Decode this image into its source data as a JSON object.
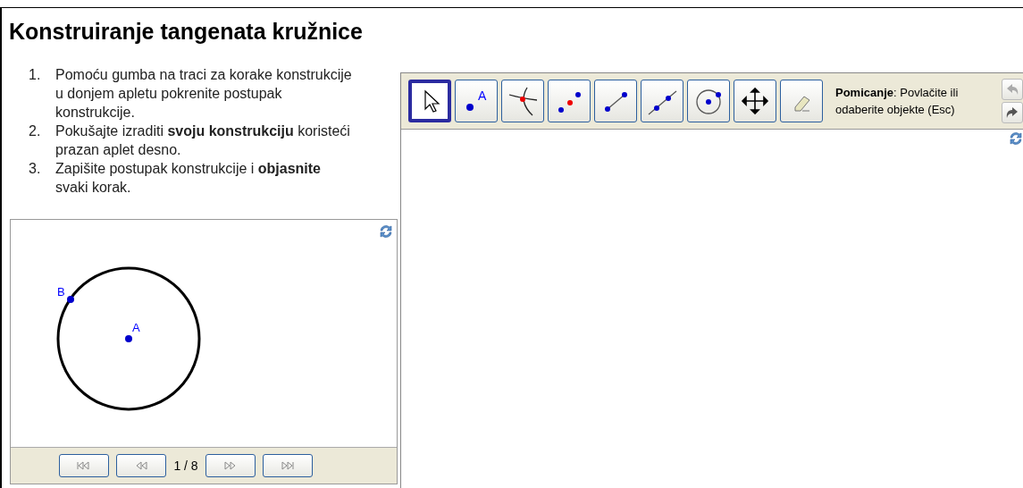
{
  "title": "Konstruiranje tangenata kružnice",
  "instructions": [
    {
      "number": "1.",
      "text": "Pomoću gumba na traci za korake konstrukcije u donjem apletu pokrenite postupak konstrukcije."
    },
    {
      "number": "2.",
      "text": "Pokušajte izraditi **svoju konstrukciju** koristeći prazan aplet desno."
    },
    {
      "number": "3.",
      "text": "Zapišite postupak konstrukcije i **objasnite** svaki korak."
    }
  ],
  "construction_applet": {
    "points": [
      {
        "label": "A",
        "kind": "center"
      },
      {
        "label": "B",
        "kind": "on-circle"
      }
    ],
    "navigation": {
      "buttons": [
        {
          "kind": "first"
        },
        {
          "kind": "back"
        },
        {
          "kind": "forward"
        },
        {
          "kind": "last"
        }
      ],
      "step": "1 / 8"
    }
  },
  "drawing_applet": {
    "tools": [
      {
        "kind": "move",
        "selected": true
      },
      {
        "kind": "point",
        "selected": false,
        "label": "A"
      },
      {
        "kind": "intersect",
        "selected": false
      },
      {
        "kind": "midpoint",
        "selected": false
      },
      {
        "kind": "segment",
        "selected": false
      },
      {
        "kind": "line",
        "selected": false
      },
      {
        "kind": "circle",
        "selected": false
      },
      {
        "kind": "pan",
        "selected": false
      },
      {
        "kind": "eraser",
        "selected": false
      }
    ],
    "help": "**Pomicanje**: Povlačite ili odaberite objekte (Esc)",
    "undo_disabled": true,
    "redo_disabled": false
  }
}
